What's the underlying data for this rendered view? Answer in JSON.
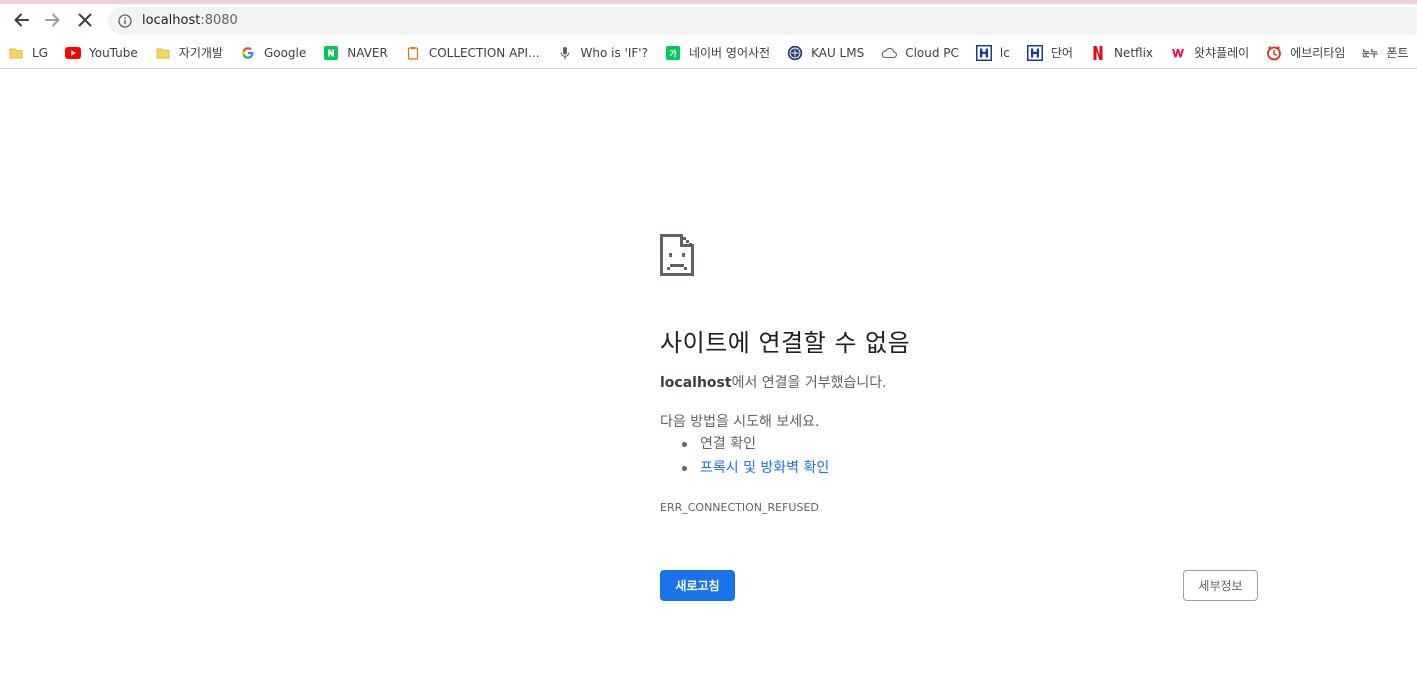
{
  "browser": {
    "url_host": "localhost",
    "url_port": ":8080"
  },
  "bookmarks": [
    {
      "label": "LG",
      "icon": "folder-icon"
    },
    {
      "label": "YouTube",
      "icon": "youtube-icon"
    },
    {
      "label": "자기개발",
      "icon": "folder-icon"
    },
    {
      "label": "Google",
      "icon": "google-icon"
    },
    {
      "label": "NAVER",
      "icon": "naver-icon"
    },
    {
      "label": "COLLECTION API...",
      "icon": "clipboard-icon"
    },
    {
      "label": "Who is 'IF'?",
      "icon": "microphone-icon"
    },
    {
      "label": "네이버 영어사전",
      "icon": "naver-dictionary-icon"
    },
    {
      "label": "KAU LMS",
      "icon": "kau-emblem-icon"
    },
    {
      "label": "Cloud PC",
      "icon": "cloud-icon"
    },
    {
      "label": "lc",
      "icon": "h-logo-icon"
    },
    {
      "label": "단어",
      "icon": "h-logo-icon"
    },
    {
      "label": "Netflix",
      "icon": "netflix-icon"
    },
    {
      "label": "왓챠플레이",
      "icon": "watcha-icon"
    },
    {
      "label": "에브리타임",
      "icon": "everytime-icon"
    },
    {
      "label": "폰트",
      "icon": "font-icon"
    }
  ],
  "error": {
    "title": "사이트에 연결할 수 없음",
    "host_bold": "localhost",
    "host_message": "에서 연결을 거부했습니다.",
    "try_text": "다음 방법을 시도해 보세요.",
    "suggestions": [
      "연결 확인",
      "프록시 및 방화벽 확인"
    ],
    "code": "ERR_CONNECTION_REFUSED",
    "reload_button": "새로고침",
    "details_button": "세부정보"
  },
  "colors": {
    "accent": "#1a73e8",
    "text_secondary": "#5f6368"
  }
}
